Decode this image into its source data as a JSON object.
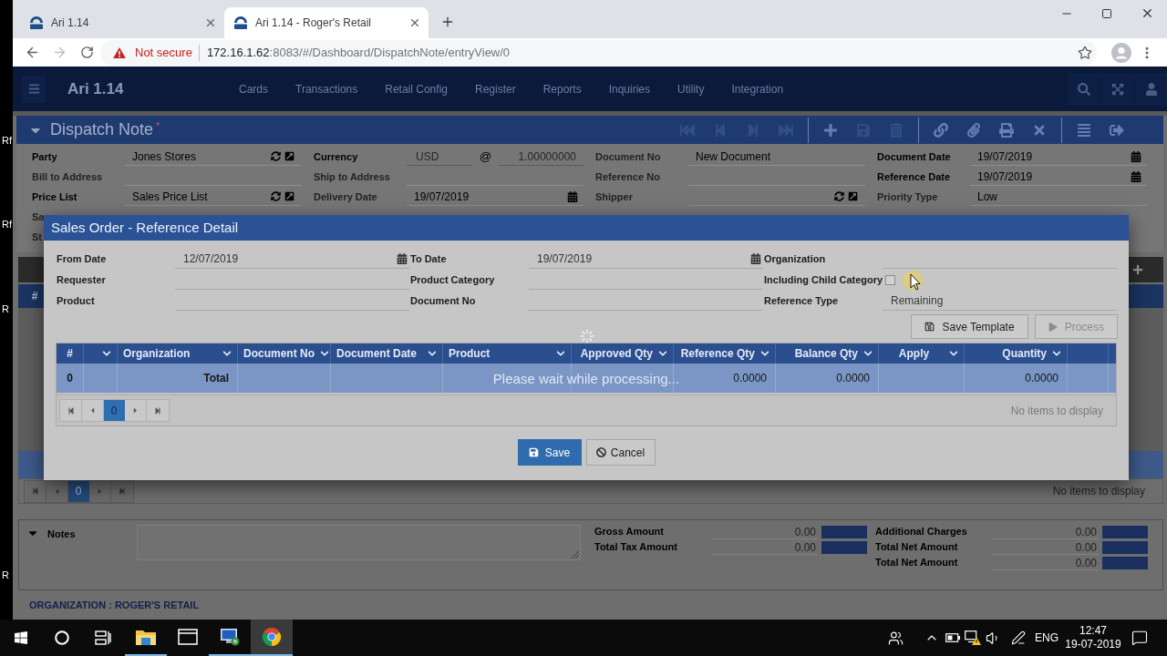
{
  "desktop": {
    "icon_labels": [
      "Rf",
      "Rf",
      "R",
      "R"
    ]
  },
  "browser": {
    "tabs": [
      {
        "title": "Ari 1.14",
        "selected": false
      },
      {
        "title": "Ari 1.14 - Roger's Retail",
        "selected": true
      }
    ],
    "address_bar": {
      "security": "Not secure",
      "host": "172.16.1.62",
      "path": ":8083/#/Dashboard/DispatchNote/entryView/0"
    }
  },
  "app_header": {
    "title": "Ari 1.14",
    "nav": [
      "Cards",
      "Transactions",
      "Retail Config",
      "Register",
      "Reports",
      "Inquiries",
      "Utility",
      "Integration"
    ]
  },
  "dispatch_note": {
    "title": "Dispatch Note",
    "required_mark": "*",
    "toolbar": [
      {
        "kind": "first",
        "disabled": true
      },
      {
        "kind": "prev",
        "disabled": true
      },
      {
        "kind": "next",
        "disabled": true
      },
      {
        "kind": "last",
        "disabled": true
      },
      {
        "kind": "separator"
      },
      {
        "kind": "add",
        "disabled": false
      },
      {
        "kind": "save",
        "disabled": true
      },
      {
        "kind": "delete",
        "disabled": true
      },
      {
        "kind": "separator"
      },
      {
        "kind": "link",
        "disabled": false
      },
      {
        "kind": "attach",
        "disabled": false
      },
      {
        "kind": "print",
        "disabled": false
      },
      {
        "kind": "cancel",
        "disabled": false
      },
      {
        "kind": "separator"
      },
      {
        "kind": "list",
        "disabled": false
      },
      {
        "kind": "exit",
        "disabled": false
      }
    ],
    "form": [
      [
        {
          "label": "Party",
          "required": true,
          "kind": "lookup",
          "value": "Jones Stores",
          "disabled": false
        },
        {
          "label": "Bill to Address",
          "required": false,
          "kind": "text",
          "disabled": false
        },
        {
          "label": "Price List",
          "required": true,
          "kind": "lookup",
          "value": "Sales Price List",
          "disabled": false
        }
      ],
      [
        {
          "label": "Currency",
          "required": true,
          "kind": "currency",
          "value": "USD",
          "rate_sign": "@",
          "rate": "1.00000000",
          "disabled": true
        },
        {
          "label": "Ship to Address",
          "required": false,
          "kind": "text",
          "disabled": false
        },
        {
          "label": "Delivery Date",
          "required": false,
          "kind": "date",
          "value": "19/07/2019",
          "disabled": false
        }
      ],
      [
        {
          "label": "Document No",
          "required": false,
          "kind": "text",
          "value": "New Document",
          "disabled": false
        },
        {
          "label": "Reference No",
          "required": false,
          "kind": "text",
          "disabled": false
        },
        {
          "label": "Shipper",
          "required": false,
          "kind": "lookup",
          "disabled": false
        }
      ],
      [
        {
          "label": "Document Date",
          "required": true,
          "kind": "date",
          "value": "19/07/2019",
          "disabled": false
        },
        {
          "label": "Reference Date",
          "required": true,
          "kind": "date",
          "value": "19/07/2019",
          "disabled": false
        },
        {
          "label": "Priority Type",
          "required": false,
          "kind": "text",
          "value": "Low",
          "disabled": false
        }
      ]
    ],
    "covered_labels": [
      "Sa",
      "St"
    ],
    "lines_grid": {
      "columns": [
        "#"
      ],
      "pager": {
        "pages": [
          {
            "label": "0",
            "selected": true
          }
        ],
        "status": "No items to display"
      }
    },
    "notes": {
      "label": "Notes"
    },
    "totals": [
      [
        {
          "label": "Gross Amount",
          "value": "0.00"
        },
        {
          "label": "Total Tax Amount",
          "value": "0.00"
        }
      ],
      [
        {
          "label": "Additional Charges",
          "value": "0.00"
        },
        {
          "label": "Total Net Amount",
          "value": "0.00"
        },
        {
          "label": "Total Net Amount",
          "value": "0.00"
        }
      ]
    ]
  },
  "dialog": {
    "title": "Sales Order - Reference Detail",
    "filters": [
      [
        {
          "label": "From Date",
          "kind": "date",
          "value": "12/07/2019"
        },
        {
          "label": "Requester",
          "kind": "text"
        },
        {
          "label": "Product",
          "kind": "text"
        }
      ],
      [
        {
          "label": "To Date",
          "kind": "date",
          "value": "19/07/2019"
        },
        {
          "label": "Product Category",
          "kind": "text"
        },
        {
          "label": "Document No",
          "kind": "text"
        }
      ],
      [
        {
          "label": "Organization",
          "kind": "text"
        },
        {
          "label": "Including Child Category",
          "kind": "checkbox",
          "checked": false
        },
        {
          "label": "Reference Type",
          "kind": "text",
          "value": "Remaining"
        }
      ]
    ],
    "actions": [
      {
        "label": "Save Template",
        "kind": "save",
        "disabled": false
      },
      {
        "label": "Process",
        "kind": "run",
        "disabled": true
      }
    ],
    "grid": {
      "columns": [
        {
          "label": "#",
          "menu": false
        },
        {
          "menu": true
        },
        {
          "label": "Organization",
          "menu": true
        },
        {
          "label": "Document No",
          "menu": true
        },
        {
          "label": "Document Date",
          "menu": true
        },
        {
          "label": "Product",
          "menu": true
        },
        {
          "label": "Approved Qty",
          "menu": true
        },
        {
          "label": "Reference Qty",
          "menu": true
        },
        {
          "label": "Balance Qty",
          "menu": true
        },
        {
          "label": "Apply",
          "menu": true
        },
        {
          "label": "Quantity",
          "menu": true
        },
        {
          "menu": false
        }
      ],
      "rows": [
        {
          "cells": [
            "0",
            null,
            "Total",
            null,
            null,
            null,
            null,
            "0.0000",
            "0.0000",
            null,
            "0.0000",
            null
          ]
        }
      ],
      "loading_message": "Please wait while processing...",
      "pager": {
        "pages": [
          {
            "label": "0",
            "selected": true
          }
        ],
        "status": "No items to display"
      }
    },
    "buttons": [
      {
        "label": "Save",
        "kind": "save"
      },
      {
        "label": "Cancel",
        "kind": "cancel"
      }
    ]
  },
  "status_bar": {
    "organization": "ORGANIZATION : ROGER'S RETAIL"
  },
  "taskbar": {
    "apps": [
      {
        "kind": "explorer",
        "running": true,
        "selected": false
      },
      {
        "kind": "window",
        "running": false,
        "selected": false
      },
      {
        "kind": "remote",
        "running": true,
        "selected": false
      },
      {
        "kind": "chrome",
        "running": true,
        "selected": true
      }
    ],
    "language": "ENG",
    "time": "12:47",
    "date": "19-07-2019"
  }
}
